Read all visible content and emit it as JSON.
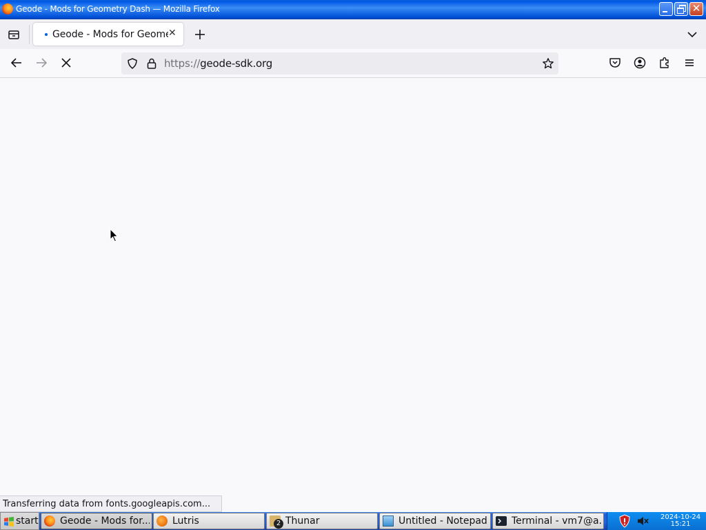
{
  "window": {
    "title": "Geode - Mods for Geometry Dash — Mozilla Firefox"
  },
  "tabs": [
    {
      "label": "Geode - Mods for Geometry Dash",
      "active": true
    }
  ],
  "navbar": {
    "url_protocol": "https://",
    "url_host": "geode-sdk.org"
  },
  "status": {
    "text": "Transferring data from fonts.googleapis.com..."
  },
  "taskbar": {
    "start_label": "start",
    "tasks": [
      {
        "label": "Geode - Mods for...",
        "icon": "firefox-icon",
        "active": true
      },
      {
        "label": "Lutris",
        "icon": "lutris-icon",
        "active": false
      },
      {
        "label": "Thunar",
        "icon": "thunar-icon",
        "badge": "2",
        "active": false
      },
      {
        "label": "Untitled - Notepad",
        "icon": "notepad-icon",
        "active": false
      },
      {
        "label": "Terminal - vm7@a...",
        "icon": "terminal-icon",
        "active": false
      }
    ],
    "clock_date": "2024-10-24",
    "clock_time": "15:21"
  },
  "colors": {
    "accent": "#0060df",
    "taskbar": "#245edb",
    "titlebar": "#0058e6"
  }
}
